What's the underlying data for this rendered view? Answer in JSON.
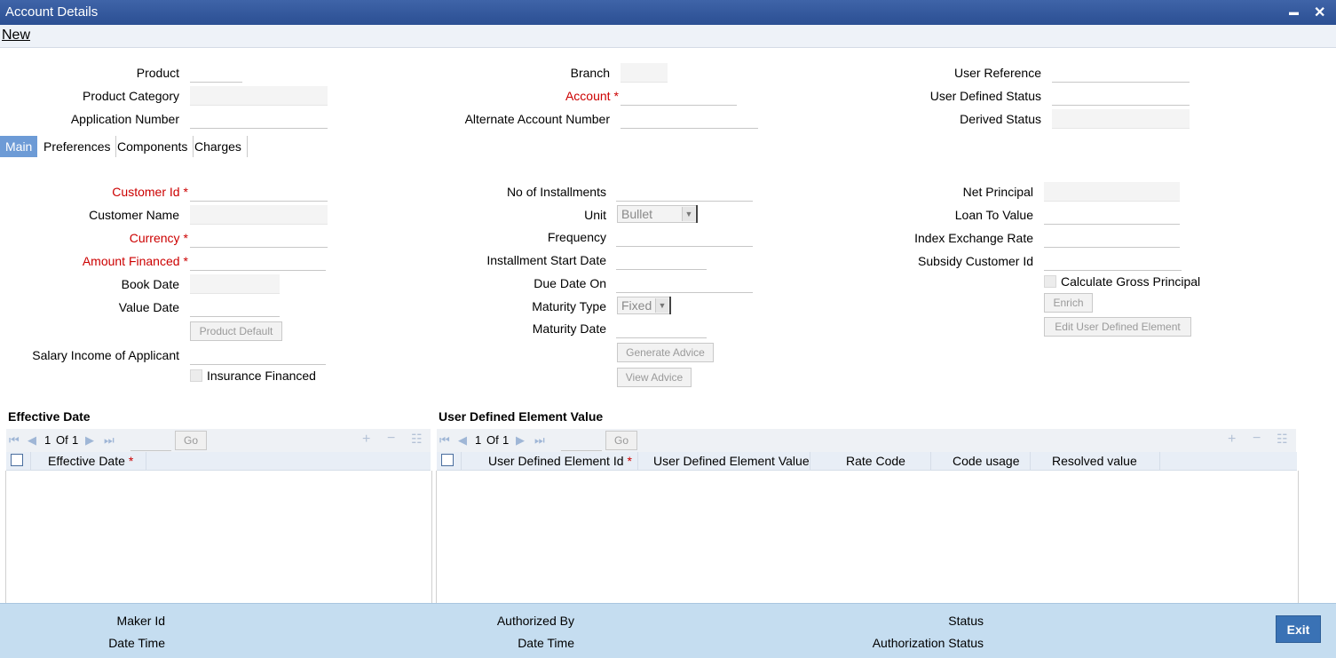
{
  "window": {
    "title": "Account Details",
    "minimize": "▬",
    "close": "✕"
  },
  "menu": {
    "new": "New"
  },
  "header": {
    "product": "Product",
    "product_category": "Product Category",
    "application_number": "Application Number",
    "branch": "Branch",
    "account": "Account",
    "alternate_account_number": "Alternate Account Number",
    "user_reference": "User Reference",
    "user_defined_status": "User Defined Status",
    "derived_status": "Derived Status",
    "required_mark": "*"
  },
  "tabs": [
    "Main",
    "Preferences",
    "Components",
    "Charges"
  ],
  "main": {
    "customer_id": "Customer Id",
    "customer_name": "Customer Name",
    "currency": "Currency",
    "amount_financed": "Amount Financed",
    "book_date": "Book Date",
    "value_date": "Value Date",
    "product_default": "Product Default",
    "salary_income": "Salary Income of Applicant",
    "insurance_financed": "Insurance Financed",
    "no_of_installments": "No of Installments",
    "unit": "Unit",
    "unit_value": "Bullet",
    "frequency": "Frequency",
    "installment_start_date": "Installment Start Date",
    "due_date_on": "Due Date On",
    "maturity_type": "Maturity Type",
    "maturity_type_value": "Fixed",
    "maturity_date": "Maturity Date",
    "generate_advice": "Generate Advice",
    "view_advice": "View Advice",
    "net_principal": "Net Principal",
    "loan_to_value": "Loan To Value",
    "index_exchange_rate": "Index Exchange Rate",
    "subsidy_customer_id": "Subsidy Customer Id",
    "calculate_gross_principal": "Calculate Gross Principal",
    "enrich": "Enrich",
    "edit_ude": "Edit User Defined Element"
  },
  "effective_grid": {
    "title": "Effective Date",
    "page": "1",
    "of": "Of",
    "total": "1",
    "go": "Go",
    "columns": [
      "Effective Date"
    ]
  },
  "ude_grid": {
    "title": "User Defined Element Value",
    "page": "1",
    "of": "Of",
    "total": "1",
    "go": "Go",
    "columns": [
      "User Defined Element Id",
      "User Defined Element Value",
      "Rate Code",
      "Code usage",
      "Resolved value"
    ]
  },
  "footer": {
    "maker_id": "Maker Id",
    "date_time_1": "Date Time",
    "authorized_by": "Authorized By",
    "date_time_2": "Date Time",
    "status": "Status",
    "authorization_status": "Authorization Status",
    "exit": "Exit"
  }
}
